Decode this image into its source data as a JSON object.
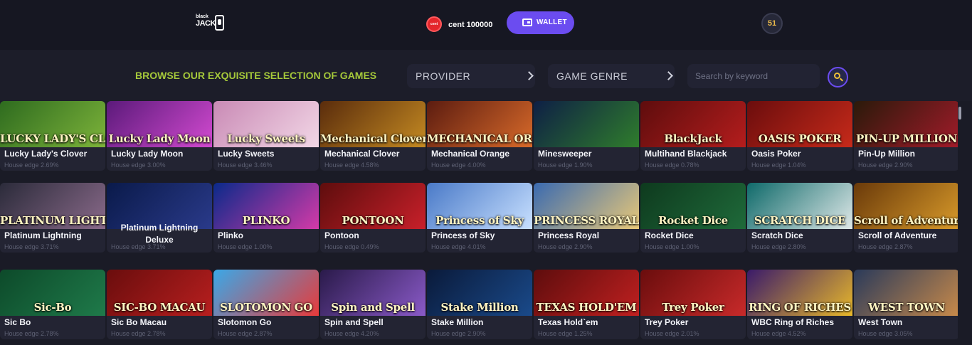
{
  "header": {
    "logo_line1": "black",
    "logo_line2": "JACK",
    "coin_label": "cent",
    "balance": "cent 100000",
    "wallet_label": "WALLET",
    "notification_count": "51"
  },
  "filters": {
    "title": "BROWSE OUR EXQUISITE SELECTION OF GAMES",
    "provider_label": "PROVIDER",
    "genre_label": "GAME GENRE",
    "search_placeholder": "Search by keyword"
  },
  "games": [
    {
      "name": "Lucky Lady's Clover",
      "edge": "House edge 2.69%",
      "thumb": "LUCKY LADY'S CLOVER",
      "colors": [
        "#2e6b1f",
        "#7db33a"
      ]
    },
    {
      "name": "Lucky Lady Moon",
      "edge": "House edge 3.00%",
      "thumb": "Lucky Lady Moon",
      "colors": [
        "#5b1a7a",
        "#d24ad0"
      ]
    },
    {
      "name": "Lucky Sweets",
      "edge": "House edge 3.46%",
      "thumb": "Lucky Sweets",
      "colors": [
        "#c98ab5",
        "#f2d7e6"
      ]
    },
    {
      "name": "Mechanical Clover",
      "edge": "House edge 4.58%",
      "thumb": "Mechanical Clover",
      "colors": [
        "#5a2c0c",
        "#c48a22"
      ]
    },
    {
      "name": "Mechanical Orange",
      "edge": "House edge 4.00%",
      "thumb": "MECHANICAL ORANGE",
      "colors": [
        "#5c1c10",
        "#d86a2a"
      ]
    },
    {
      "name": "Minesweeper",
      "edge": "House edge 1.90%",
      "thumb": "",
      "colors": [
        "#0e1f45",
        "#2f7d2c"
      ]
    },
    {
      "name": "Multihand Blackjack",
      "edge": "House edge 0.78%",
      "thumb": "BlackJack",
      "colors": [
        "#5e0d0d",
        "#b41d1d"
      ]
    },
    {
      "name": "Oasis Poker",
      "edge": "House edge 1.04%",
      "thumb": "OASIS POKER",
      "colors": [
        "#6b0d0d",
        "#c62a1a"
      ]
    },
    {
      "name": "Pin-Up Million",
      "edge": "House edge 2.90%",
      "thumb": "PIN-UP MILLION",
      "colors": [
        "#2a1a0a",
        "#a21b2a"
      ]
    },
    {
      "name": "Platinum Lightning",
      "edge": "House edge 3.71%",
      "thumb": "PLATINUM LIGHTNING",
      "colors": [
        "#2b2b3a",
        "#8a6a8a"
      ]
    },
    {
      "name": "Platinum Lightning Deluxe",
      "edge": "House edge 3.71%",
      "thumb": "",
      "colors": [
        "#0a1a4a",
        "#2a3a8a"
      ]
    },
    {
      "name": "Plinko",
      "edge": "House edge 1.00%",
      "thumb": "PLINKO",
      "colors": [
        "#0a2a8a",
        "#d43aa8"
      ]
    },
    {
      "name": "Pontoon",
      "edge": "House edge 0.49%",
      "thumb": "PONTOON",
      "colors": [
        "#5e0d0d",
        "#c8202a"
      ]
    },
    {
      "name": "Princess of Sky",
      "edge": "House edge 4.01%",
      "thumb": "Princess of Sky",
      "colors": [
        "#4a7ac8",
        "#c8e0ff"
      ]
    },
    {
      "name": "Princess Royal",
      "edge": "House edge 2.90%",
      "thumb": "PRINCESS ROYAL",
      "colors": [
        "#3a6ab0",
        "#e8c878"
      ]
    },
    {
      "name": "Rocket Dice",
      "edge": "House edge 1.00%",
      "thumb": "Rocket Dice",
      "colors": [
        "#0e3a1e",
        "#1f6a3a"
      ]
    },
    {
      "name": "Scratch Dice",
      "edge": "House edge 2.80%",
      "thumb": "SCRATCH DICE",
      "colors": [
        "#0f6a6a",
        "#dfe8e8"
      ]
    },
    {
      "name": "Scroll of Adventure",
      "edge": "House edge 2.87%",
      "thumb": "Scroll of Adventure",
      "colors": [
        "#6a3a0a",
        "#d89a2a"
      ]
    },
    {
      "name": "Sic Bo",
      "edge": "House edge 2.78%",
      "thumb": "Sic-Bo",
      "colors": [
        "#0d4a2a",
        "#1f7a4a"
      ]
    },
    {
      "name": "Sic Bo Macau",
      "edge": "House edge 2.78%",
      "thumb": "SIC-BO MACAU",
      "colors": [
        "#6a0d0d",
        "#b81f1f"
      ]
    },
    {
      "name": "Slotomon Go",
      "edge": "House edge 2.87%",
      "thumb": "SLOTOMON GO",
      "colors": [
        "#3aa8e8",
        "#e83a3a"
      ]
    },
    {
      "name": "Spin and Spell",
      "edge": "House edge 4.20%",
      "thumb": "Spin and Spell",
      "colors": [
        "#2a1a4a",
        "#8a5ac8"
      ]
    },
    {
      "name": "Stake Million",
      "edge": "House edge 2.90%",
      "thumb": "Stake Million",
      "colors": [
        "#0a1a3a",
        "#1a4a8a"
      ]
    },
    {
      "name": "Texas Hold`em",
      "edge": "House edge 1.25%",
      "thumb": "TEXAS HOLD'EM",
      "colors": [
        "#5e0d0d",
        "#c02020"
      ]
    },
    {
      "name": "Trey Poker",
      "edge": "House edge 2.01%",
      "thumb": "Trey Poker",
      "colors": [
        "#6a0d0d",
        "#c82a2a"
      ]
    },
    {
      "name": "WBC Ring of Riches",
      "edge": "House edge 4.52%",
      "thumb": "RING OF RICHES",
      "colors": [
        "#3a1a6a",
        "#e8b82a"
      ]
    },
    {
      "name": "West Town",
      "edge": "House edge 3.05%",
      "thumb": "WEST TOWN",
      "colors": [
        "#2a3a5a",
        "#c88a4a"
      ]
    }
  ]
}
